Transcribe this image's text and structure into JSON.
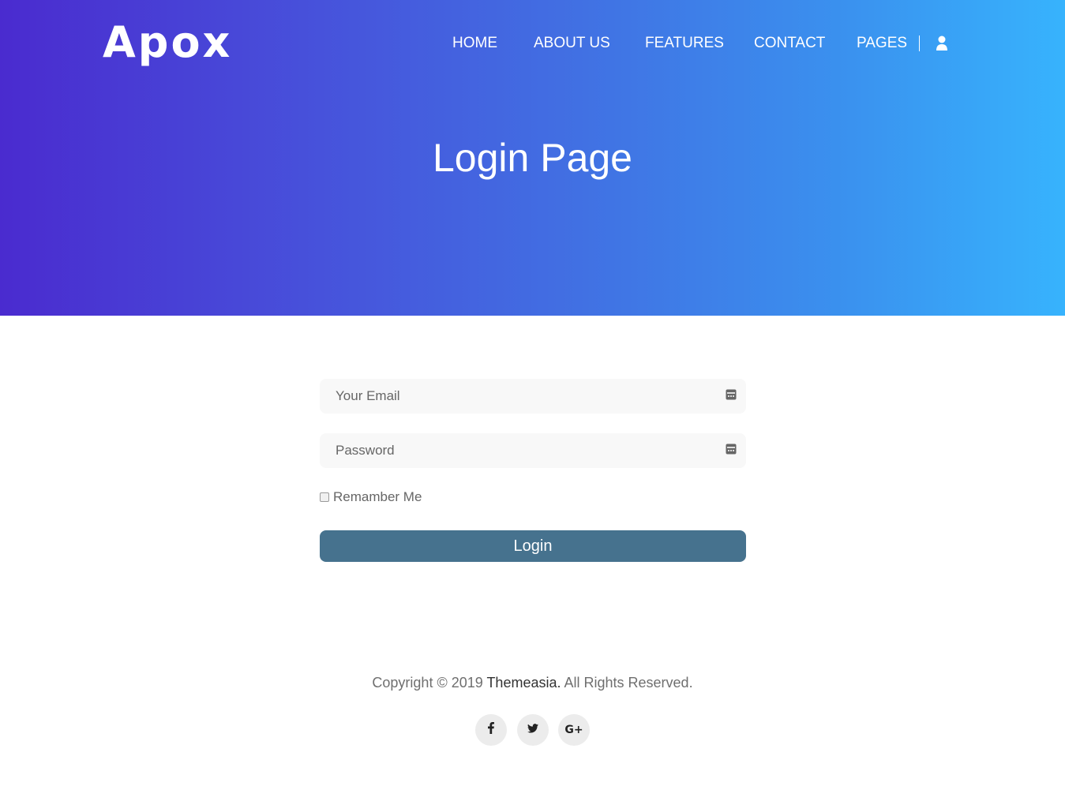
{
  "brand": {
    "logo_text": "Apox"
  },
  "nav": {
    "items": [
      {
        "label": "HOME"
      },
      {
        "label": "ABOUT US"
      },
      {
        "label": "FEATURES"
      },
      {
        "label": "CONTACT"
      },
      {
        "label": "PAGES"
      }
    ],
    "user_icon": "user-icon"
  },
  "hero": {
    "title": "Login Page"
  },
  "login_form": {
    "email_placeholder": "Your Email",
    "email_value": "",
    "password_placeholder": "Password",
    "password_value": "",
    "field_icon": "password-manager-icon",
    "remember_label": "Remamber Me",
    "remember_checked": false,
    "login_label": "Login"
  },
  "footer": {
    "copyright_prefix": "Copyright © 2019",
    "company": "Themeasia.",
    "copyright_suffix": "All Rights Reserved.",
    "social": [
      {
        "icon": "facebook-icon"
      },
      {
        "icon": "twitter-icon"
      },
      {
        "icon": "google-plus-icon",
        "text": "G+"
      }
    ]
  },
  "colors": {
    "hero_gradient_start": "#4a2bcf",
    "hero_gradient_end": "#37b3fd",
    "login_button": "#46728e",
    "field_background": "#f8f8f8",
    "social_background": "#ececec"
  }
}
